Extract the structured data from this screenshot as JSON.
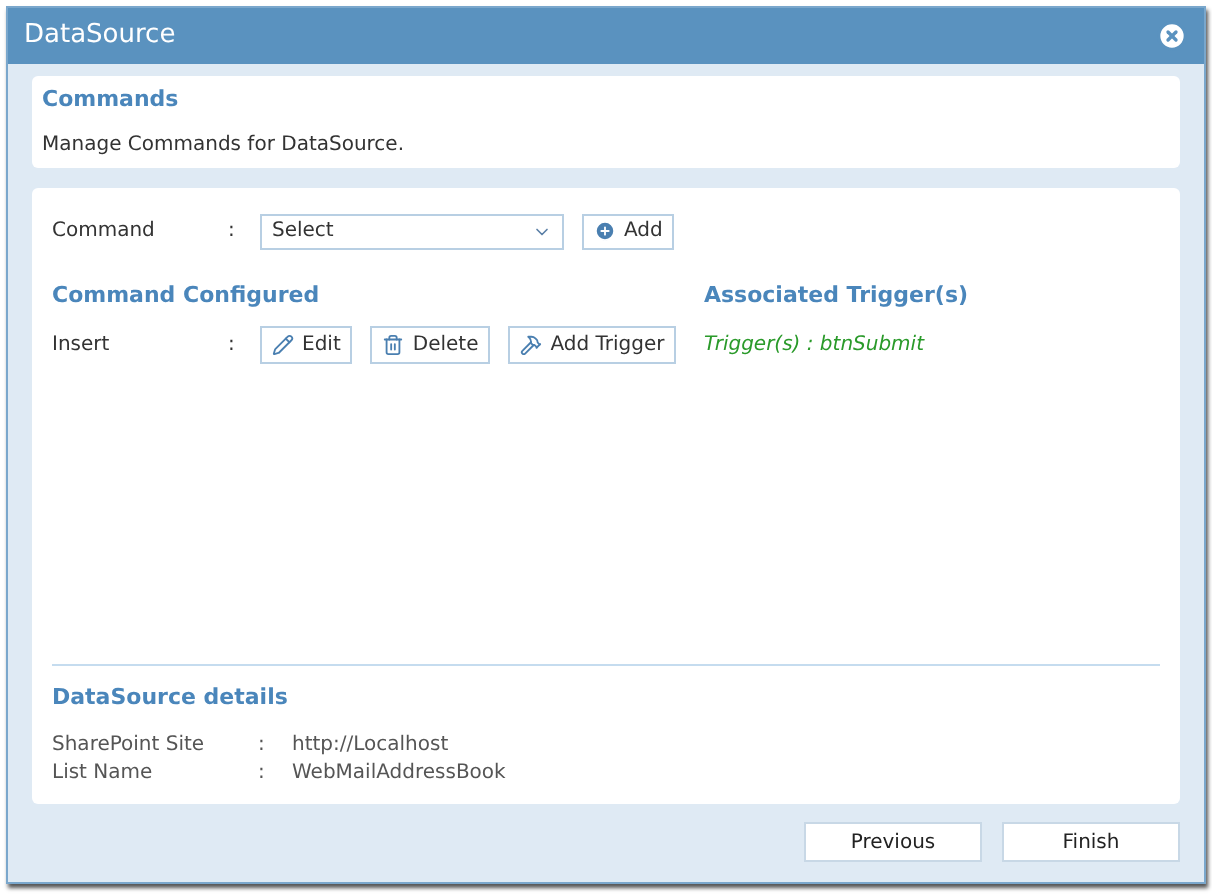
{
  "window": {
    "title": "DataSource"
  },
  "intro": {
    "title": "Commands",
    "description": "Manage Commands for DataSource."
  },
  "command_field": {
    "label": "Command",
    "separator": ":",
    "value": "Select",
    "add_button": "Add"
  },
  "configured": {
    "heading": "Command Configured",
    "trigger_heading": "Associated Trigger(s)",
    "rows": [
      {
        "name": "Insert",
        "separator": ":",
        "actions": [
          {
            "kind": "edit",
            "label": "Edit"
          },
          {
            "kind": "delete",
            "label": "Delete"
          },
          {
            "kind": "trigger",
            "label": "Add Trigger"
          }
        ],
        "triggers": "Trigger(s) : btnSubmit"
      }
    ]
  },
  "details": {
    "heading": "DataSource details",
    "rows": [
      {
        "label": "SharePoint Site",
        "separator": ":",
        "value": "http://Localhost"
      },
      {
        "label": "List Name",
        "separator": ":",
        "value": "WebMailAddressBook"
      }
    ]
  },
  "buttons": [
    "Previous",
    "Finish"
  ]
}
